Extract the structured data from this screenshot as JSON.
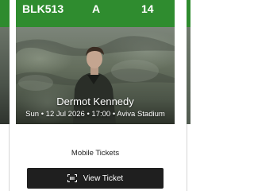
{
  "ticket": {
    "section": "BLK513",
    "row": "A",
    "seat": "14",
    "artist": "Dermot Kennedy",
    "event_info": "Sun • 12 Jul 2026 • 17:00 • Aviva Stadium",
    "delivery_type": "Mobile Tickets",
    "view_button_label": "View Ticket",
    "view_button_icon": "barcode-scan-icon"
  },
  "colors": {
    "header_green": "#2f8c2f",
    "button_dark": "#1f1f1f"
  }
}
